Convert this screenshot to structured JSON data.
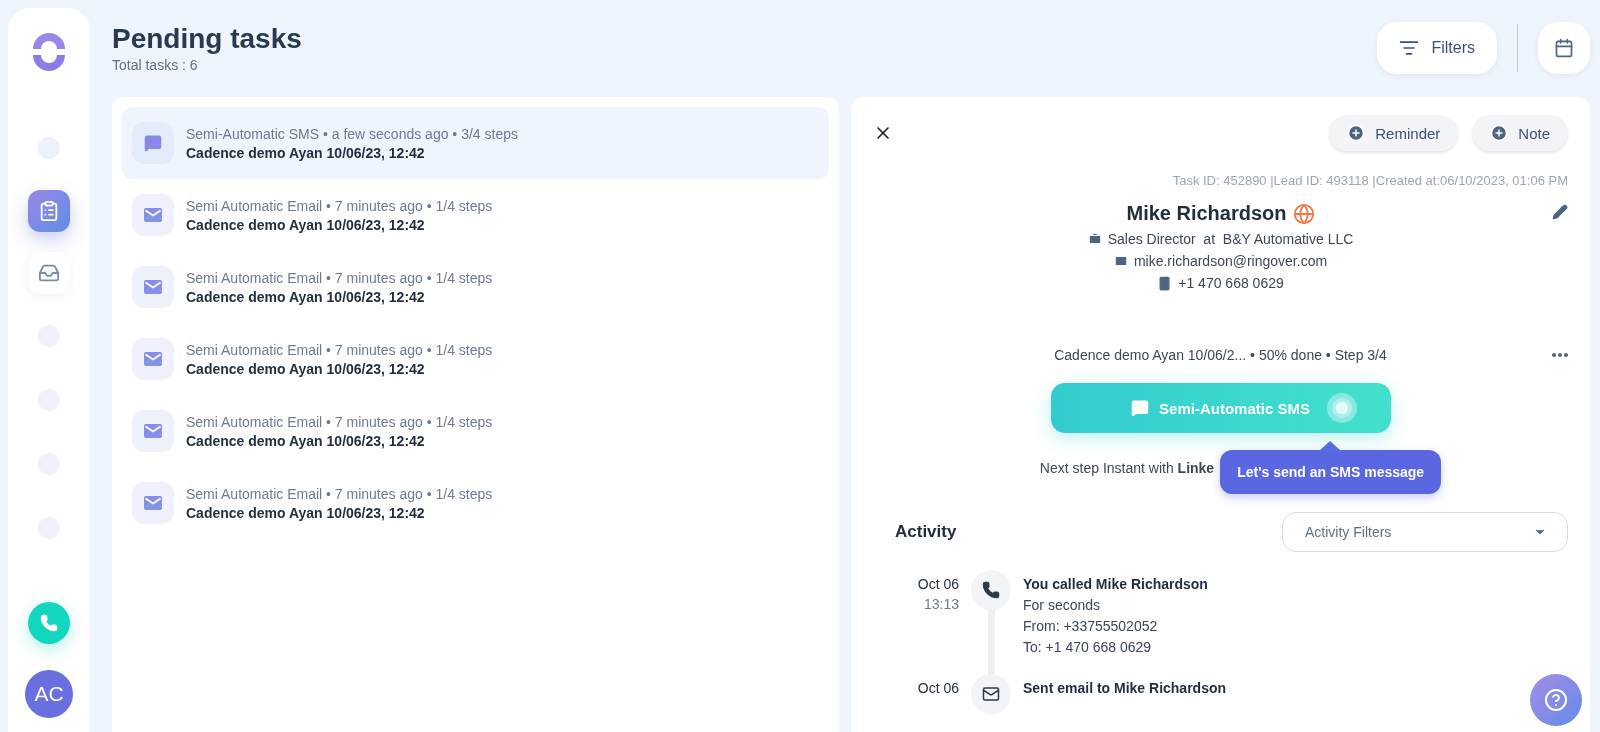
{
  "sidebar": {
    "items": [
      {
        "kind": "dot",
        "selected": false
      },
      {
        "kind": "tasks",
        "selected": true
      },
      {
        "kind": "inbox",
        "selected": false
      },
      {
        "kind": "dot",
        "selected": false
      },
      {
        "kind": "dot",
        "selected": false
      },
      {
        "kind": "dot",
        "selected": false
      },
      {
        "kind": "dot",
        "selected": false
      }
    ],
    "avatar": "AC"
  },
  "header": {
    "title": "Pending tasks",
    "subtitle": "Total tasks : 6",
    "filters_button": "Filters"
  },
  "tasks": [
    {
      "kind": "sms",
      "meta": "Semi-Automatic SMS • a few seconds ago • 3/4 steps",
      "cadence": "Cadence demo Ayan 10/06/23, 12:42",
      "selected": true
    },
    {
      "kind": "email",
      "meta": "Semi Automatic Email • 7 minutes ago • 1/4 steps",
      "cadence": "Cadence demo Ayan 10/06/23, 12:42",
      "selected": false
    },
    {
      "kind": "email",
      "meta": "Semi Automatic Email • 7 minutes ago • 1/4 steps",
      "cadence": "Cadence demo Ayan 10/06/23, 12:42",
      "selected": false
    },
    {
      "kind": "email",
      "meta": "Semi Automatic Email • 7 minutes ago • 1/4 steps",
      "cadence": "Cadence demo Ayan 10/06/23, 12:42",
      "selected": false
    },
    {
      "kind": "email",
      "meta": "Semi Automatic Email • 7 minutes ago • 1/4 steps",
      "cadence": "Cadence demo Ayan 10/06/23, 12:42",
      "selected": false
    },
    {
      "kind": "email",
      "meta": "Semi Automatic Email • 7 minutes ago • 1/4 steps",
      "cadence": "Cadence demo Ayan 10/06/23, 12:42",
      "selected": false
    }
  ],
  "detail": {
    "buttons": [
      "Reminder",
      "Note"
    ],
    "meta": "Task ID: 452890 |Lead ID: 493118 |Created at:06/10/2023, 01:06 PM",
    "name": "Mike Richardson",
    "job": "Sales Director  at  B&Y Automative LLC",
    "email": "mike.richardson@ringover.com",
    "phone": "+1 470 668 0629",
    "cadence": "Cadence demo Ayan 10/06/2... • 50% done • Step 3/4",
    "action": "Semi-Automatic SMS",
    "next_step": "Next step Instant with **Linke**",
    "tooltip": "Let's send an SMS message",
    "activity": {
      "title": "Activity",
      "filter_placeholder": "Activity Filters",
      "items": [
        {
          "kind": "call",
          "date": "Oct 06",
          "time": "13:13",
          "title": "You called Mike Richardson",
          "lines": [
            "For seconds",
            "From: +33755502052",
            "To: +1 470 668 0629"
          ]
        },
        {
          "kind": "email",
          "date": "Oct 06",
          "title": "Sent email to Mike Richardson"
        }
      ]
    }
  }
}
